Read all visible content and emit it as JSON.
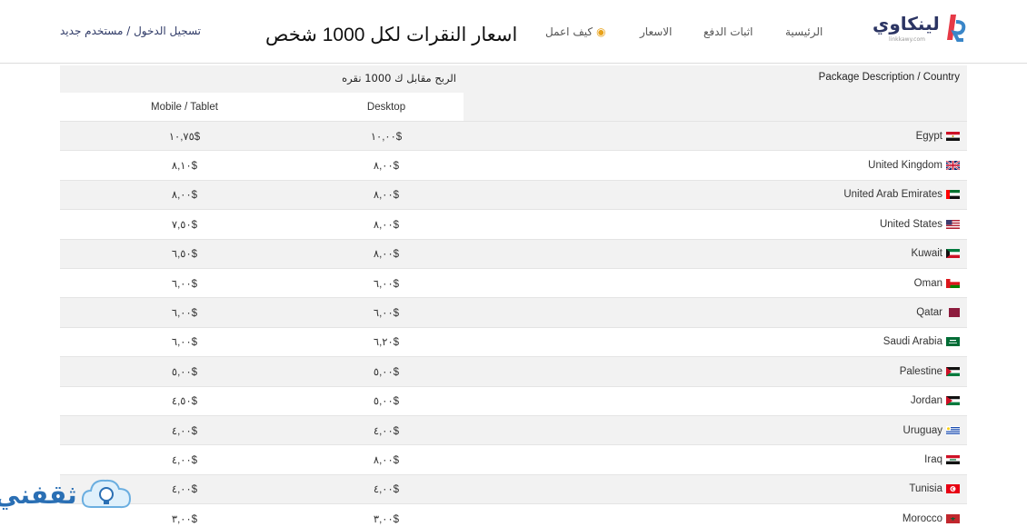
{
  "header": {
    "login": "تسجيل الدخول / مستخدم جديد",
    "overlay_title": "اسعار النقرات لكل 1000 شخص",
    "nav": {
      "how": "كيف اعمل",
      "prices": "الاسعار",
      "proof": "اثبات الدفع",
      "home": "الرئيسية"
    },
    "logo_text": "لينكاوي",
    "logo_sub": "linkkawy.com"
  },
  "table": {
    "earn_label": "الربح مقابل ك 1000 نقره",
    "package_label": "Package Description / Country",
    "col_desktop": "Desktop",
    "col_mobile": "Mobile / Tablet",
    "rows": [
      {
        "country": "Egypt",
        "desktop": "١٠,٠٠$",
        "mobile": "١٠,٧٥$",
        "flag": "egypt"
      },
      {
        "country": "United Kingdom",
        "desktop": "٨,٠٠$",
        "mobile": "٨,١٠$",
        "flag": "uk"
      },
      {
        "country": "United Arab Emirates",
        "desktop": "٨,٠٠$",
        "mobile": "٨,٠٠$",
        "flag": "uae"
      },
      {
        "country": "United States",
        "desktop": "٨,٠٠$",
        "mobile": "٧,٥٠$",
        "flag": "us"
      },
      {
        "country": "Kuwait",
        "desktop": "٨,٠٠$",
        "mobile": "٦,٥٠$",
        "flag": "kuwait"
      },
      {
        "country": "Oman",
        "desktop": "٦,٠٠$",
        "mobile": "٦,٠٠$",
        "flag": "oman"
      },
      {
        "country": "Qatar",
        "desktop": "٦,٠٠$",
        "mobile": "٦,٠٠$",
        "flag": "qatar"
      },
      {
        "country": "Saudi Arabia",
        "desktop": "٦,٢٠$",
        "mobile": "٦,٠٠$",
        "flag": "saudi"
      },
      {
        "country": "Palestine",
        "desktop": "٥,٠٠$",
        "mobile": "٥,٠٠$",
        "flag": "palestine"
      },
      {
        "country": "Jordan",
        "desktop": "٥,٠٠$",
        "mobile": "٤,٥٠$",
        "flag": "jordan"
      },
      {
        "country": "Uruguay",
        "desktop": "٤,٠٠$",
        "mobile": "٤,٠٠$",
        "flag": "uruguay"
      },
      {
        "country": "Iraq",
        "desktop": "٨,٠٠$",
        "mobile": "٤,٠٠$",
        "flag": "iraq"
      },
      {
        "country": "Tunisia",
        "desktop": "٤,٠٠$",
        "mobile": "٤,٠٠$",
        "flag": "tunisia"
      },
      {
        "country": "Morocco",
        "desktop": "٣,٠٠$",
        "mobile": "٣,٠٠$",
        "flag": "morocco"
      }
    ]
  },
  "watermark": {
    "text": "ثقفني"
  },
  "colors": {
    "brand_navy": "#2b3463",
    "brand_red": "#e63946",
    "brand_blue": "#3a86c8",
    "row_alt": "#f2f2f2",
    "watermark_blue": "#2a6fb4"
  }
}
